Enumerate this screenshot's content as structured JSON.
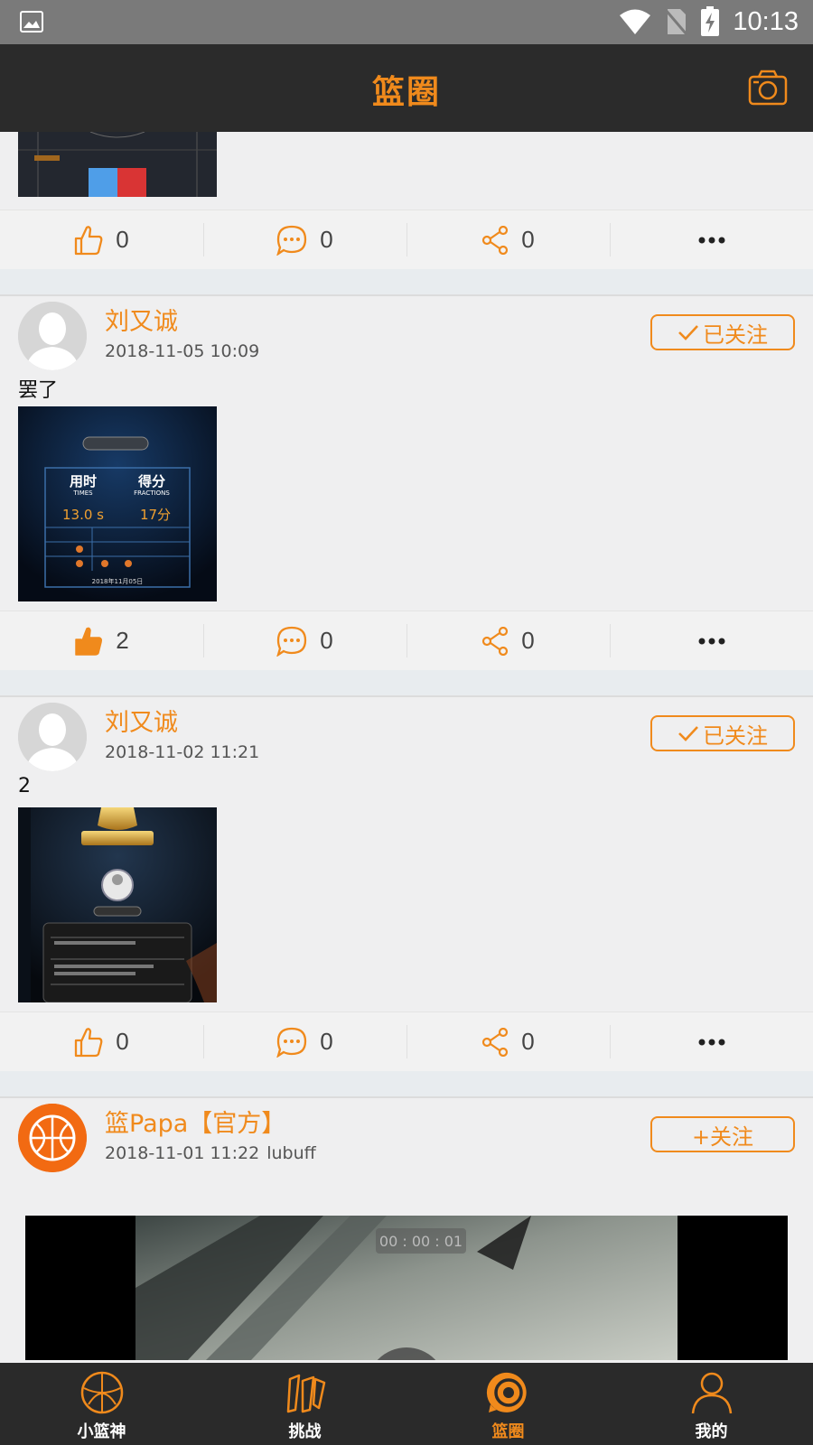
{
  "status_bar": {
    "time": "10:13"
  },
  "header": {
    "title": "篮圈"
  },
  "posts": [
    {
      "likes": "0",
      "comments": "0",
      "shares": "0"
    },
    {
      "author": "刘又诚",
      "time": "2018-11-05 10:09",
      "follow": "已关注",
      "text": "罢了",
      "likes": "2",
      "comments": "0",
      "shares": "0",
      "image": {
        "t1": "用时",
        "t1_en": "TIMES",
        "t2": "得分",
        "t2_en": "FRACTIONS",
        "v1": "13.0 s",
        "v2": "17分",
        "date": "2018年11月05日"
      }
    },
    {
      "author": "刘又诚",
      "time": "2018-11-02 11:21",
      "follow": "已关注",
      "text": "2",
      "likes": "0",
      "comments": "0",
      "shares": "0"
    },
    {
      "author": "篮Papa【官方】",
      "time": "2018-11-01 11:22",
      "source": "lubuff",
      "follow": "+关注",
      "video_timer": "00 : 00 : 01"
    }
  ],
  "tabbar": {
    "items": [
      {
        "label": "小篮神"
      },
      {
        "label": "挑战"
      },
      {
        "label": "篮圈"
      },
      {
        "label": "我的"
      }
    ]
  },
  "colors": {
    "accent": "#f08a1c",
    "header_bg": "#2b2b2b",
    "tabbar_bg": "#2a2a2a"
  }
}
